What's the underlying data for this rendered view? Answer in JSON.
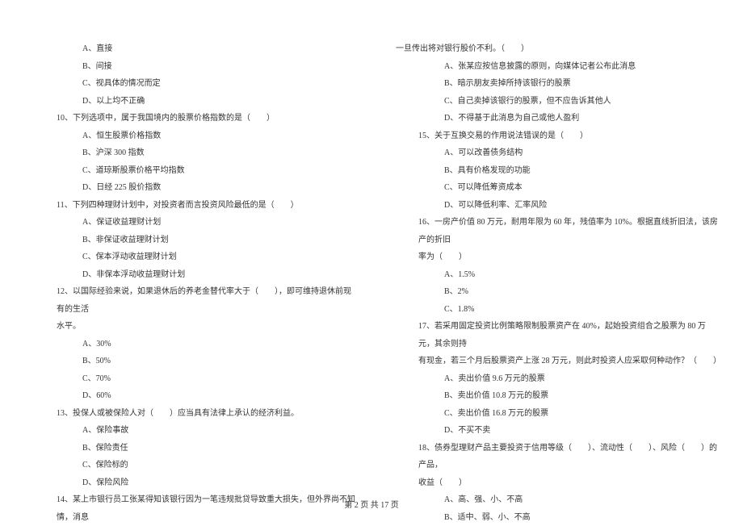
{
  "left": {
    "q9": {
      "a": "A、直接",
      "b": "B、间接",
      "c": "C、视具体的情况而定",
      "d": "D、以上均不正确"
    },
    "q10": {
      "stem": "10、下列选项中，属于我国境内的股票价格指数的是（　　）",
      "a": "A、恒生股票价格指数",
      "b": "B、沪深 300 指数",
      "c": "C、道琼斯股票价格平均指数",
      "d": "D、日经 225 股价指数"
    },
    "q11": {
      "stem": "11、下列四种理财计划中，对投资者而言投资风险最低的是（　　）",
      "a": "A、保证收益理财计划",
      "b": "B、非保证收益理财计划",
      "c": "C、保本浮动收益理财计划",
      "d": "D、非保本浮动收益理财计划"
    },
    "q12": {
      "stem1": "12、以国际经验来说，如果退休后的养老金替代率大于（　　），即可维持退休前现有的生活",
      "stem2": "水平。",
      "a": "A、30%",
      "b": "B、50%",
      "c": "C、70%",
      "d": "D、60%"
    },
    "q13": {
      "stem": "13、投保人或被保险人对（　　）应当具有法律上承认的经济利益。",
      "a": "A、保险事故",
      "b": "B、保险责任",
      "c": "C、保险标的",
      "d": "D、保险风险"
    },
    "q14": {
      "stem": "14、某上市银行员工张某得知该银行因为一笔违规批贷导致重大损失，但外界尚不知情，消息"
    }
  },
  "right": {
    "q14": {
      "cont": "一旦传出将对银行股价不利。（　　）",
      "a": "A、张某应按信息披露的原则，向媒体记者公布此消息",
      "b": "B、暗示朋友卖掉所持该银行的股票",
      "c": "C、自己卖掉该银行的股票，但不应告诉其他人",
      "d": "D、不得基于此消息为自己或他人盈利"
    },
    "q15": {
      "stem": "15、关于互换交易的作用说法错误的是（　　）",
      "a": "A、可以改善债务结构",
      "b": "B、具有价格发现的功能",
      "c": "C、可以降低筹资成本",
      "d": "D、可以降低利率、汇率风险"
    },
    "q16": {
      "stem1": "16、一房产价值 80 万元，耐用年限为 60 年，残值率为 10%。根据直线折旧法，该房产的折旧",
      "stem2": "率为（　　）",
      "a": "A、1.5%",
      "b": "B、2%",
      "c": "C、1.8%"
    },
    "q17": {
      "stem1": "17、若采用固定投资比例策略限制股票资产在 40%，起始投资组合之股票为 80 万元，其余则持",
      "stem2": "有现金，若三个月后股票资产上涨 28 万元，则此时投资人应采取何种动作？（　　）",
      "a": "A、卖出价值 9.6 万元的股票",
      "b": "B、卖出价值 10.8 万元的股票",
      "c": "C、卖出价值 16.8 万元的股票",
      "d": "D、不买不卖"
    },
    "q18": {
      "stem1": "18、债券型理财产品主要投资于信用等级（　　）、流动性（　　）、风险（　　）的产品，",
      "stem2": "收益（　　）",
      "a": "A、高、强、小、不高",
      "b": "B、适中、弱、小、不高"
    }
  },
  "footer": "第 2 页 共 17 页"
}
